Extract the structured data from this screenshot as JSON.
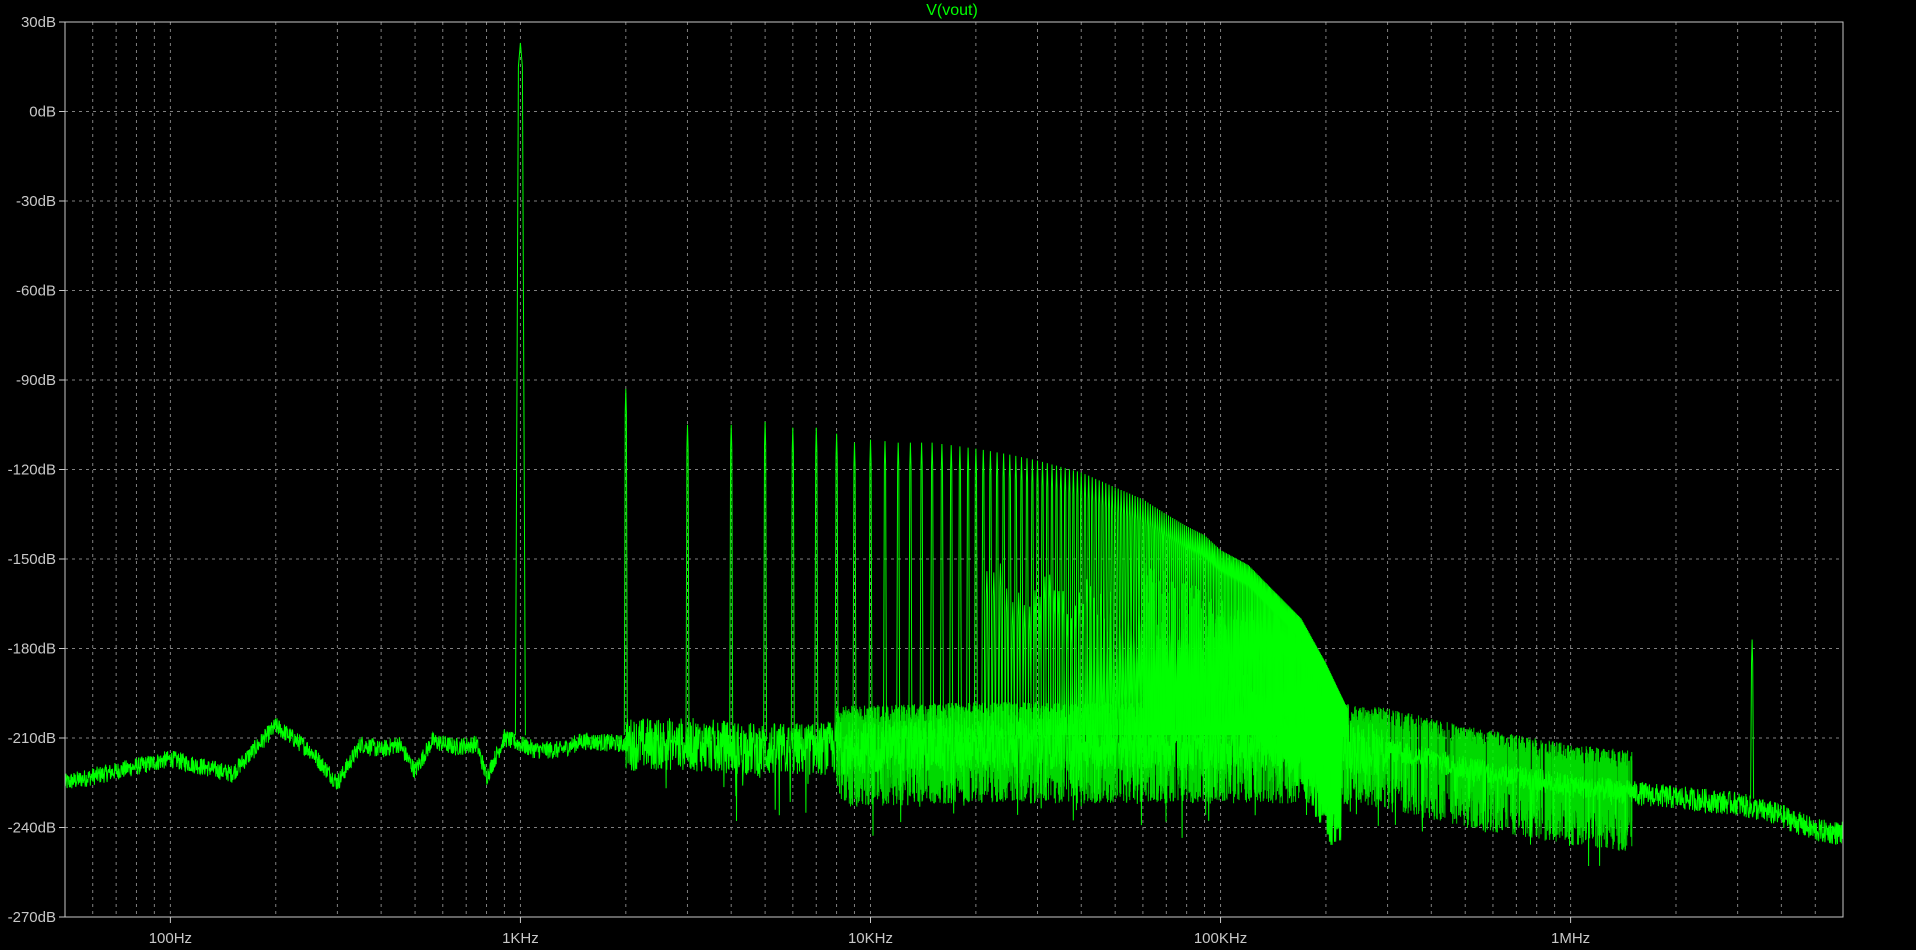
{
  "chart_data": {
    "type": "line",
    "title": "V(vout)",
    "xlabel": "",
    "ylabel": "",
    "x_scale": "log",
    "xlim": [
      50,
      6000000
    ],
    "ylim": [
      -270,
      30
    ],
    "grid": true,
    "colors": {
      "background": "#000000",
      "trace": "#00ff00",
      "axis": "#c8c8c8",
      "grid": "#808080"
    },
    "y_ticks": [
      {
        "value": 30,
        "label": "30dB"
      },
      {
        "value": 0,
        "label": "0dB"
      },
      {
        "value": -30,
        "label": "-30dB"
      },
      {
        "value": -60,
        "label": "-60dB"
      },
      {
        "value": -90,
        "label": "-90dB"
      },
      {
        "value": -120,
        "label": "-120dB"
      },
      {
        "value": -150,
        "label": "-150dB"
      },
      {
        "value": -180,
        "label": "-180dB"
      },
      {
        "value": -210,
        "label": "-210dB"
      },
      {
        "value": -240,
        "label": "-240dB"
      },
      {
        "value": -270,
        "label": "-270dB"
      }
    ],
    "x_ticks": [
      {
        "value": 100,
        "label": "100Hz"
      },
      {
        "value": 1000,
        "label": "1KHz"
      },
      {
        "value": 10000,
        "label": "10KHz"
      },
      {
        "value": 100000,
        "label": "100KHz"
      },
      {
        "value": 1000000,
        "label": "1MHz"
      }
    ],
    "series": [
      {
        "color": "#00ff00",
        "baseline_noise_floor": [
          [
            50,
            -225
          ],
          [
            100,
            -217
          ],
          [
            150,
            -222
          ],
          [
            200,
            -206
          ],
          [
            250,
            -214
          ],
          [
            300,
            -225
          ],
          [
            350,
            -212
          ],
          [
            400,
            -214
          ],
          [
            450,
            -212
          ],
          [
            500,
            -221
          ],
          [
            560,
            -211
          ],
          [
            650,
            -213
          ],
          [
            750,
            -212
          ],
          [
            800,
            -223
          ],
          [
            900,
            -210
          ],
          [
            1100,
            -214
          ],
          [
            1300,
            -214
          ],
          [
            1500,
            -211
          ],
          [
            2000,
            -212
          ],
          [
            3000,
            -212
          ],
          [
            5000,
            -214
          ],
          [
            10000,
            -213
          ],
          [
            20000,
            -212
          ],
          [
            50000,
            -212
          ],
          [
            100000,
            -212
          ],
          [
            200000,
            -212
          ],
          [
            300000,
            -214
          ],
          [
            500000,
            -220
          ],
          [
            1000000,
            -226
          ],
          [
            2000000,
            -230
          ],
          [
            3000000,
            -232
          ],
          [
            4000000,
            -236
          ],
          [
            5000000,
            -241
          ],
          [
            6000000,
            -242
          ]
        ],
        "harmonics": [
          [
            1000,
            23
          ],
          [
            2000,
            -93
          ],
          [
            3000,
            -105
          ],
          [
            4000,
            -105
          ],
          [
            5000,
            -104
          ],
          [
            6000,
            -106
          ],
          [
            7000,
            -106
          ],
          [
            8000,
            -108
          ],
          [
            9000,
            -111
          ],
          [
            10000,
            -110
          ],
          [
            12000,
            -111
          ],
          [
            15000,
            -111
          ],
          [
            20000,
            -113
          ],
          [
            25000,
            -115
          ],
          [
            30000,
            -117
          ],
          [
            40000,
            -121
          ],
          [
            50000,
            -126
          ],
          [
            60000,
            -130
          ],
          [
            70000,
            -135
          ],
          [
            80000,
            -139
          ],
          [
            90000,
            -142
          ],
          [
            100000,
            -147
          ],
          [
            120000,
            -152
          ],
          [
            140000,
            -160
          ],
          [
            170000,
            -170
          ],
          [
            200000,
            -185
          ],
          [
            230000,
            -200
          ]
        ],
        "spur": [
          3300000,
          -177
        ]
      }
    ]
  }
}
